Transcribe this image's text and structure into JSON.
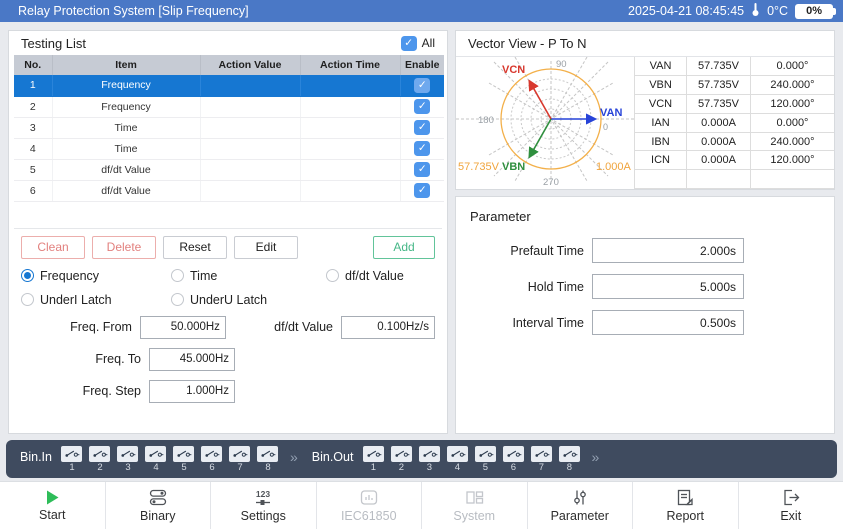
{
  "titlebar": {
    "title": "Relay Protection System [Slip Frequency]",
    "datetime": "2025-04-21 08:45:45",
    "temperature": "0°C",
    "battery": "0%"
  },
  "testing_list": {
    "title": "Testing List",
    "all_label": "All",
    "columns": [
      "No.",
      "Item",
      "Action Value",
      "Action Time",
      "Enable"
    ],
    "rows": [
      {
        "no": "1",
        "item": "Frequency",
        "action_value": "",
        "action_time": "",
        "enabled": true,
        "selected": true
      },
      {
        "no": "2",
        "item": "Frequency",
        "action_value": "",
        "action_time": "",
        "enabled": true
      },
      {
        "no": "3",
        "item": "Time",
        "action_value": "",
        "action_time": "",
        "enabled": true
      },
      {
        "no": "4",
        "item": "Time",
        "action_value": "",
        "action_time": "",
        "enabled": true
      },
      {
        "no": "5",
        "item": "df/dt Value",
        "action_value": "",
        "action_time": "",
        "enabled": true
      },
      {
        "no": "6",
        "item": "df/dt Value",
        "action_value": "",
        "action_time": "",
        "enabled": true
      }
    ],
    "buttons": {
      "clean": "Clean",
      "delete": "Delete",
      "reset": "Reset",
      "edit": "Edit",
      "add": "Add"
    },
    "mode_radios": [
      {
        "label": "Frequency",
        "selected": true
      },
      {
        "label": "Time",
        "selected": false
      },
      {
        "label": "df/dt Value",
        "selected": false
      }
    ],
    "latch_radios": [
      {
        "label": "UnderI Latch",
        "selected": false
      },
      {
        "label": "UnderU Latch",
        "selected": false
      }
    ],
    "fields": {
      "freq_from": {
        "label": "Freq. From",
        "value": "50.000Hz"
      },
      "dfdt": {
        "label": "df/dt Value",
        "value": "0.100Hz/s"
      },
      "freq_to": {
        "label": "Freq. To",
        "value": "45.000Hz"
      },
      "freq_step": {
        "label": "Freq. Step",
        "value": "1.000Hz"
      }
    }
  },
  "vector_view": {
    "title": "Vector View - P To N",
    "polar": {
      "angle_labels": {
        "top": "90",
        "left": "180",
        "bottom": "270",
        "right": "0"
      },
      "voltage_scale": "57.735V",
      "current_scale": "1.000A",
      "vector_labels": {
        "van": "VAN",
        "vbn": "VBN",
        "vcn": "VCN"
      }
    },
    "phasors": [
      {
        "name": "VAN",
        "magnitude": "57.735V",
        "angle": "0.000°"
      },
      {
        "name": "VBN",
        "magnitude": "57.735V",
        "angle": "240.000°"
      },
      {
        "name": "VCN",
        "magnitude": "57.735V",
        "angle": "120.000°"
      },
      {
        "name": "IAN",
        "magnitude": "0.000A",
        "angle": "0.000°"
      },
      {
        "name": "IBN",
        "magnitude": "0.000A",
        "angle": "240.000°"
      },
      {
        "name": "ICN",
        "magnitude": "0.000A",
        "angle": "120.000°"
      }
    ]
  },
  "parameter": {
    "title": "Parameter",
    "fields": [
      {
        "label": "Prefault Time",
        "value": "2.000s"
      },
      {
        "label": "Hold Time",
        "value": "5.000s"
      },
      {
        "label": "Interval Time",
        "value": "0.500s"
      }
    ]
  },
  "binary_bar": {
    "bin_in_label": "Bin.In",
    "bin_out_label": "Bin.Out",
    "chevron": "»",
    "bin_in": [
      "1",
      "2",
      "3",
      "4",
      "5",
      "6",
      "7",
      "8"
    ],
    "bin_out": [
      "1",
      "2",
      "3",
      "4",
      "5",
      "6",
      "7",
      "8"
    ]
  },
  "toolbar": {
    "items": [
      {
        "label": "Start",
        "disabled": false
      },
      {
        "label": "Binary",
        "disabled": false
      },
      {
        "label": "Settings",
        "disabled": false
      },
      {
        "label": "IEC61850",
        "disabled": true
      },
      {
        "label": "System",
        "disabled": true
      },
      {
        "label": "Parameter",
        "disabled": false
      },
      {
        "label": "Report",
        "disabled": false
      },
      {
        "label": "Exit",
        "disabled": false
      }
    ]
  },
  "colors": {
    "titlebar_blue": "#4a78c6",
    "selected_row_blue": "#1677d2",
    "checkbox_blue": "#4d96ec",
    "danger_red": "#e2807e",
    "add_green": "#45b787",
    "start_green": "#2ebd59",
    "polar_orange": "#f0a43c",
    "van_blue": "#2743d8",
    "vbn_green": "#2f8f3e",
    "vcn_red": "#d8382e",
    "bar_dark": "#3f4b5f"
  }
}
